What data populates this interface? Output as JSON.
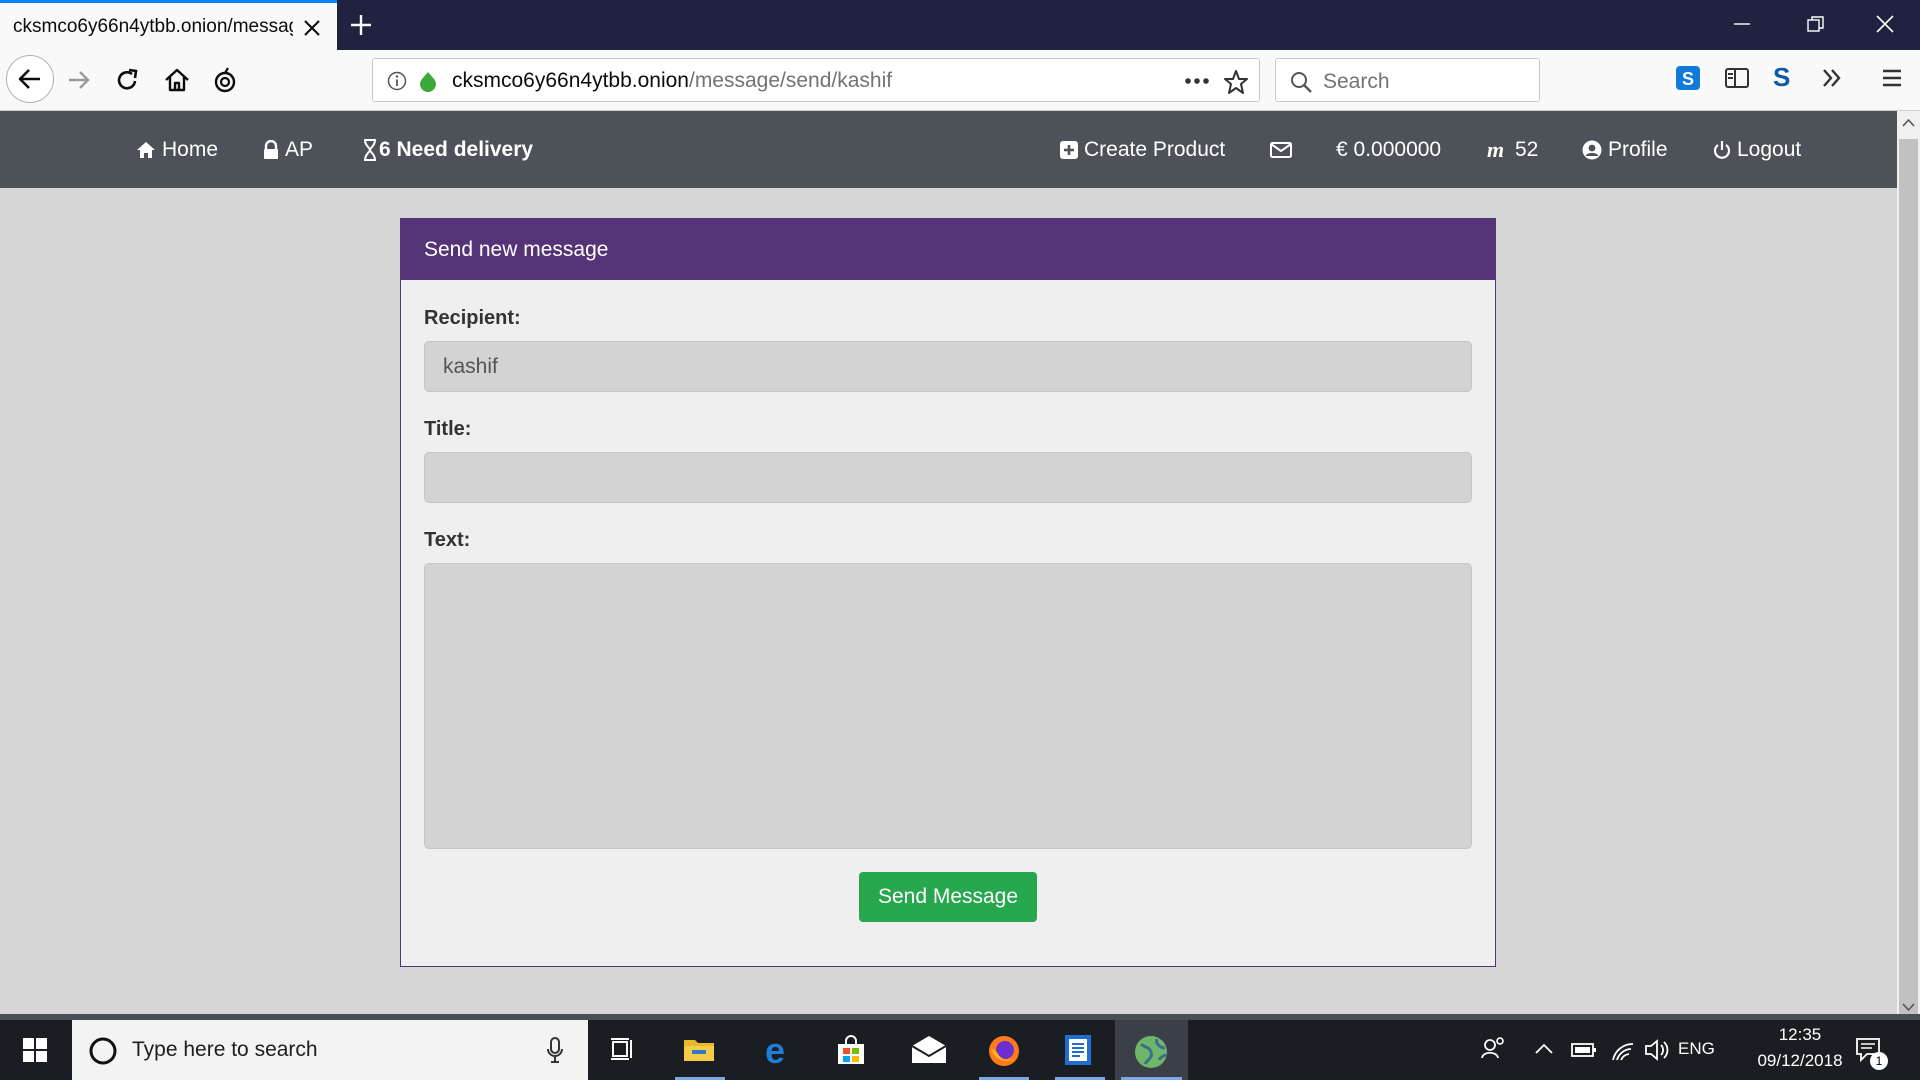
{
  "browser": {
    "tab_title": "cksmco6y66n4ytbb.onion/message/send/kashif",
    "url_domain": "cksmco6y66n4ytbb.onion",
    "url_path": "/message/send/kashif",
    "search_placeholder": "Search",
    "s_addon_label": "S"
  },
  "site_nav": {
    "home": "Home",
    "ap": "AP",
    "need_delivery": "6 Need delivery",
    "create_product": "Create Product",
    "balance": "€ 0.000000",
    "m_count": "52",
    "profile": "Profile",
    "logout": "Logout"
  },
  "form": {
    "header": "Send new message",
    "recipient_label": "Recipient:",
    "recipient_value": "kashif",
    "title_label": "Title:",
    "title_value": "",
    "text_label": "Text:",
    "text_value": "",
    "submit_label": "Send Message"
  },
  "taskbar": {
    "search_placeholder": "Type here to search",
    "language": "ENG",
    "time": "12:35",
    "date": "09/12/2018",
    "notification_count": "1"
  },
  "colors": {
    "card_header": "#553377",
    "site_nav": "#4c5257",
    "submit_button": "#27a84e",
    "tab_bar": "#1f2340"
  }
}
